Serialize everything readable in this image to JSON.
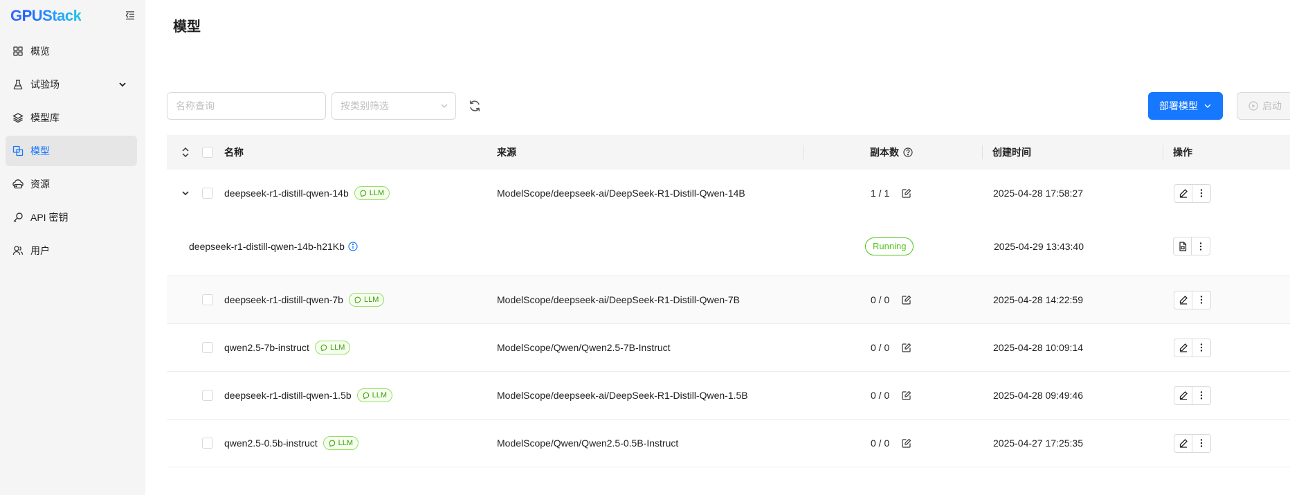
{
  "app": {
    "logo_first": "G",
    "logo_rest": "PUStack"
  },
  "sidebar": {
    "items": [
      {
        "label": "概览"
      },
      {
        "label": "试验场"
      },
      {
        "label": "模型库"
      },
      {
        "label": "模型"
      },
      {
        "label": "资源"
      },
      {
        "label": "API 密钥"
      },
      {
        "label": "用户"
      }
    ]
  },
  "page": {
    "title": "模型"
  },
  "toolbar": {
    "search_placeholder": "名称查询",
    "filter_placeholder": "按类别筛选",
    "deploy_label": "部署模型",
    "start_label": "启动"
  },
  "table": {
    "headers": {
      "name": "名称",
      "source": "来源",
      "replicas": "副本数",
      "created": "创建时间",
      "actions": "操作"
    },
    "rows": [
      {
        "name": "deepseek-r1-distill-qwen-14b",
        "tag": "LLM",
        "source": "ModelScope/deepseek-ai/DeepSeek-R1-Distill-Qwen-14B",
        "replicas": "1 / 1",
        "created": "2025-04-28 17:58:27"
      },
      {
        "name": "deepseek-r1-distill-qwen-7b",
        "tag": "LLM",
        "source": "ModelScope/deepseek-ai/DeepSeek-R1-Distill-Qwen-7B",
        "replicas": "0 / 0",
        "created": "2025-04-28 14:22:59"
      },
      {
        "name": "qwen2.5-7b-instruct",
        "tag": "LLM",
        "source": "ModelScope/Qwen/Qwen2.5-7B-Instruct",
        "replicas": "0 / 0",
        "created": "2025-04-28 10:09:14"
      },
      {
        "name": "deepseek-r1-distill-qwen-1.5b",
        "tag": "LLM",
        "source": "ModelScope/deepseek-ai/DeepSeek-R1-Distill-Qwen-1.5B",
        "replicas": "0 / 0",
        "created": "2025-04-28 09:49:46"
      },
      {
        "name": "qwen2.5-0.5b-instruct",
        "tag": "LLM",
        "source": "ModelScope/Qwen/Qwen2.5-0.5B-Instruct",
        "replicas": "0 / 0",
        "created": "2025-04-27 17:25:35"
      }
    ],
    "instance": {
      "name": "deepseek-r1-distill-qwen-14b-h21Kb",
      "status": "Running",
      "created": "2025-04-29 13:43:40"
    }
  }
}
